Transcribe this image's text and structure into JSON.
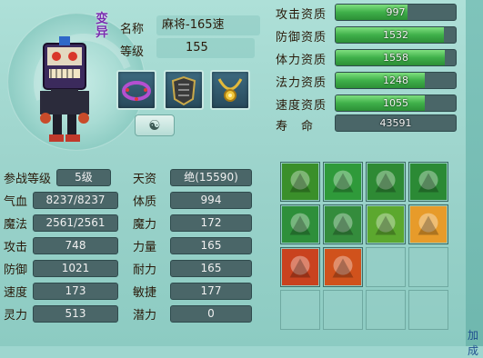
{
  "pet": {
    "badge": "变异",
    "name_label": "名称",
    "name_value": "麻将-165速",
    "level_label": "等级",
    "level_value": "155"
  },
  "equipment": [
    {
      "name": "collar",
      "icon": "ring-icon"
    },
    {
      "name": "armor",
      "icon": "armor-icon"
    },
    {
      "name": "amulet",
      "icon": "necklace-icon"
    }
  ],
  "aptitudes": [
    {
      "label": "攻击资质",
      "value": "997",
      "fill": 0.6
    },
    {
      "label": "防御资质",
      "value": "1532",
      "fill": 0.9
    },
    {
      "label": "体力资质",
      "value": "1558",
      "fill": 0.91
    },
    {
      "label": "法力资质",
      "value": "1248",
      "fill": 0.74
    },
    {
      "label": "速度资质",
      "value": "1055",
      "fill": 0.74
    },
    {
      "label": "寿　命",
      "value": "43591",
      "fill": 0.0
    }
  ],
  "stats": [
    {
      "label": "参战等级",
      "value": "5级",
      "label2": "天资",
      "value2": "绝(15590)"
    },
    {
      "label": "气血",
      "value": "8237/8237",
      "label2": "体质",
      "value2": "994"
    },
    {
      "label": "魔法",
      "value": "2561/2561",
      "label2": "魔力",
      "value2": "172"
    },
    {
      "label": "攻击",
      "value": "748",
      "label2": "力量",
      "value2": "165"
    },
    {
      "label": "防御",
      "value": "1021",
      "label2": "耐力",
      "value2": "165"
    },
    {
      "label": "速度",
      "value": "173",
      "label2": "敏捷",
      "value2": "177"
    },
    {
      "label": "灵力",
      "value": "513",
      "label2": "潜力",
      "value2": "0"
    }
  ],
  "skills": [
    {
      "name": "skill-shield",
      "color": "#3a8f2a",
      "filled": true
    },
    {
      "name": "skill-dash",
      "color": "#2f9a3a",
      "filled": true
    },
    {
      "name": "skill-horse",
      "color": "#2e8a34",
      "filled": true
    },
    {
      "name": "skill-muscle",
      "color": "#2b8a35",
      "filled": true
    },
    {
      "name": "skill-figure",
      "color": "#2e8f3a",
      "filled": true
    },
    {
      "name": "skill-turtle",
      "color": "#348c3c",
      "filled": true
    },
    {
      "name": "skill-heart",
      "color": "#5ca82e",
      "filled": true
    },
    {
      "name": "skill-sun",
      "color": "#e79b2a",
      "filled": true
    },
    {
      "name": "skill-fire-figure",
      "color": "#c9421f",
      "filled": true
    },
    {
      "name": "skill-fire-dragon",
      "color": "#d0521c",
      "filled": true
    },
    {
      "name": "empty",
      "color": "",
      "filled": false
    },
    {
      "name": "empty",
      "color": "",
      "filled": false
    },
    {
      "name": "empty",
      "color": "",
      "filled": false
    },
    {
      "name": "empty",
      "color": "",
      "filled": false
    },
    {
      "name": "empty",
      "color": "",
      "filled": false
    },
    {
      "name": "empty",
      "color": "",
      "filled": false
    }
  ],
  "right_edge_text": "加成",
  "colors": {
    "bar_fill": "#3fb04a",
    "bar_bg": "#4a6668",
    "badge": "#7a2fb0"
  }
}
